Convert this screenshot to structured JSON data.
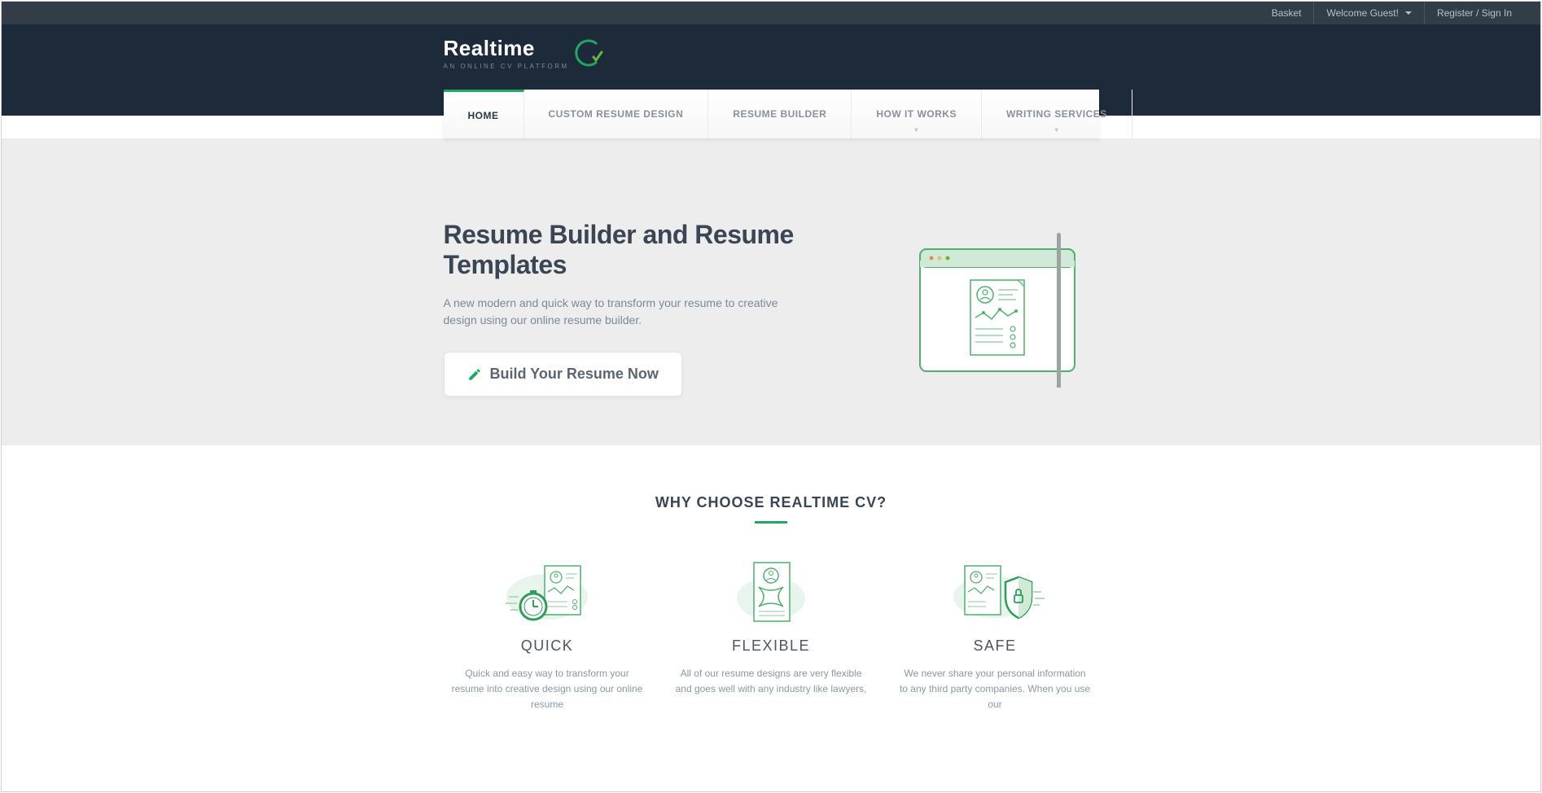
{
  "topbar": {
    "basket": "Basket",
    "welcome": "Welcome Guest!",
    "register_signin": "Register / Sign In"
  },
  "logo": {
    "text": "Realtime",
    "subtitle": "AN ONLINE CV PLATFORM"
  },
  "nav": {
    "items": [
      {
        "label": "HOME",
        "active": true,
        "dropdown": false
      },
      {
        "label": "CUSTOM RESUME DESIGN",
        "active": false,
        "dropdown": false
      },
      {
        "label": "RESUME BUILDER",
        "active": false,
        "dropdown": false
      },
      {
        "label": "HOW IT WORKS",
        "active": false,
        "dropdown": true
      },
      {
        "label": "WRITING SERVICES",
        "active": false,
        "dropdown": true
      }
    ]
  },
  "hero": {
    "title": "Resume Builder and Resume Templates",
    "description": "A new modern and quick way to transform your resume to creative design using our online resume builder.",
    "cta_label": "Build Your Resume Now"
  },
  "features": {
    "section_title": "WHY CHOOSE REALTIME CV?",
    "items": [
      {
        "title": "QUICK",
        "desc": "Quick and easy way to transform your resume into creative design using our online resume"
      },
      {
        "title": "FLEXIBLE",
        "desc": "All of our resume designs are very flexible and goes well with any industry like lawyers,"
      },
      {
        "title": "SAFE",
        "desc": "We never share your personal information to any third party companies. When you use our"
      }
    ]
  }
}
